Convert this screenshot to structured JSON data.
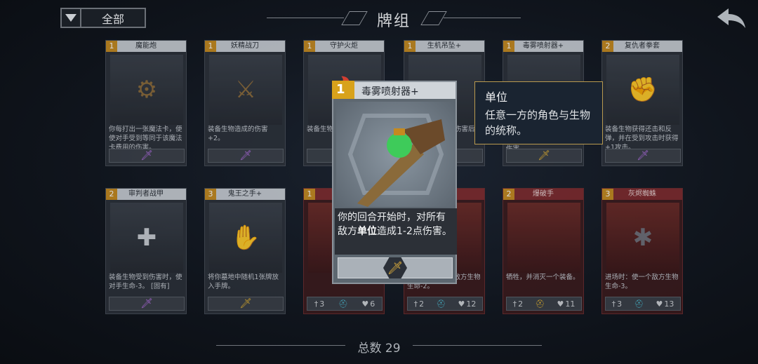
{
  "header": {
    "filter_label": "全部",
    "title": "牌组"
  },
  "cards": [
    {
      "name": "魔能炮",
      "cost": "1",
      "desc": "你每打出一张魔法卡，便使对手受到等同于该魔法卡费用的伤害。"
    },
    {
      "name": "妖精战刀",
      "cost": "1",
      "desc": "装备生物造成的伤害+2。"
    },
    {
      "name": "守护火炬",
      "cost": "1",
      "desc": "装备生物受到的伤害"
    },
    {
      "name": "生机吊坠+",
      "cost": "1",
      "desc": "伤害后"
    },
    {
      "name": "毒雾喷射器+",
      "cost": "1",
      "desc": "伤害。"
    },
    {
      "name": "复仇者拳套",
      "cost": "2",
      "desc": "装备生物获得还击和反弹，并在受到攻击时获得+1攻击。"
    },
    {
      "name": "审判者战甲",
      "cost": "2",
      "desc": "装备生物受到伤害时，使对手生命-3。 [固有]"
    },
    {
      "name": "鬼王之手+",
      "cost": "3",
      "desc": "将你墓地中随机1张牌放入手牌。"
    },
    {
      "name": "",
      "cost": "1",
      "desc": "",
      "attack": "3",
      "health": "6"
    },
    {
      "name": "",
      "cost": "",
      "desc": "进场时：使所有敌方生物生命-2。",
      "attack": "2",
      "health": "12"
    },
    {
      "name": "爆破手",
      "cost": "2",
      "desc": "牺牲，并消灭一个装备。",
      "attack": "2",
      "health": "11"
    },
    {
      "name": "灰烬蜘蛛",
      "cost": "3",
      "desc": "进场时：使一个敌方生物生命-3。",
      "attack": "3",
      "health": "13"
    }
  ],
  "selected_card": {
    "cost": "1",
    "name": "毒雾喷射器+",
    "desc_pre": "你的回合开始时，对所有敌方",
    "desc_keyword": "单位",
    "desc_post": "造成1-2点伤害。"
  },
  "tooltip": {
    "title": "单位",
    "body": "任意一方的角色与生物的统称。"
  },
  "footer": {
    "total_label": "总数 29"
  },
  "icons": {
    "filter": "dropdown-triangle-icon",
    "back": "back-arrow-icon",
    "dagger": "dagger-icon",
    "shield": "helmet-icon",
    "heart": "heart-icon"
  },
  "colors": {
    "cost_gold": "#d8a21b",
    "tooltip_border": "#b99a4f",
    "red_card": "#7d2a2d"
  }
}
